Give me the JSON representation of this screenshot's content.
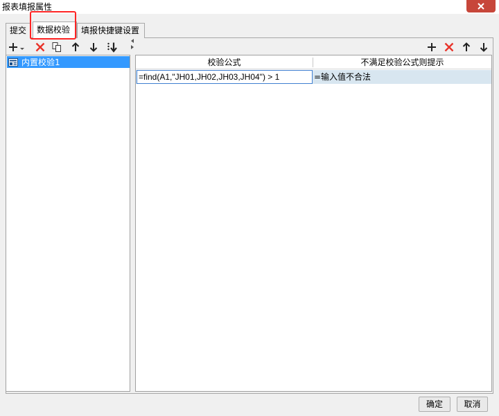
{
  "window": {
    "title": "报表填报属性"
  },
  "tabs": [
    {
      "label": "提交",
      "active": false
    },
    {
      "label": "数据校验",
      "active": true
    },
    {
      "label": "填报快捷键设置",
      "active": false
    }
  ],
  "left_toolbar": {
    "icons": [
      "add-dropdown-icon",
      "delete-icon",
      "copy-icon",
      "move-up-icon",
      "move-down-icon",
      "sort-icon"
    ]
  },
  "left_list": {
    "items": [
      {
        "label": "内置校验1",
        "selected": true
      }
    ]
  },
  "right_toolbar": {
    "icons": [
      "add-icon",
      "delete-icon",
      "move-up-icon",
      "move-down-icon"
    ]
  },
  "grid": {
    "columns": [
      "校验公式",
      "不满足校验公式则提示"
    ],
    "rows": [
      {
        "formula": "=find(A1,\"JH01,JH02,JH03,JH04\") > 1",
        "message": "=输入值不合法"
      }
    ]
  },
  "footer": {
    "ok_label": "确定",
    "cancel_label": "取消"
  },
  "colors": {
    "selection": "#3399ff",
    "delete": "#e8332a",
    "highlight_box": "#ff2424",
    "close_button": "#c7463a",
    "row_background": "#d8e6f0"
  }
}
